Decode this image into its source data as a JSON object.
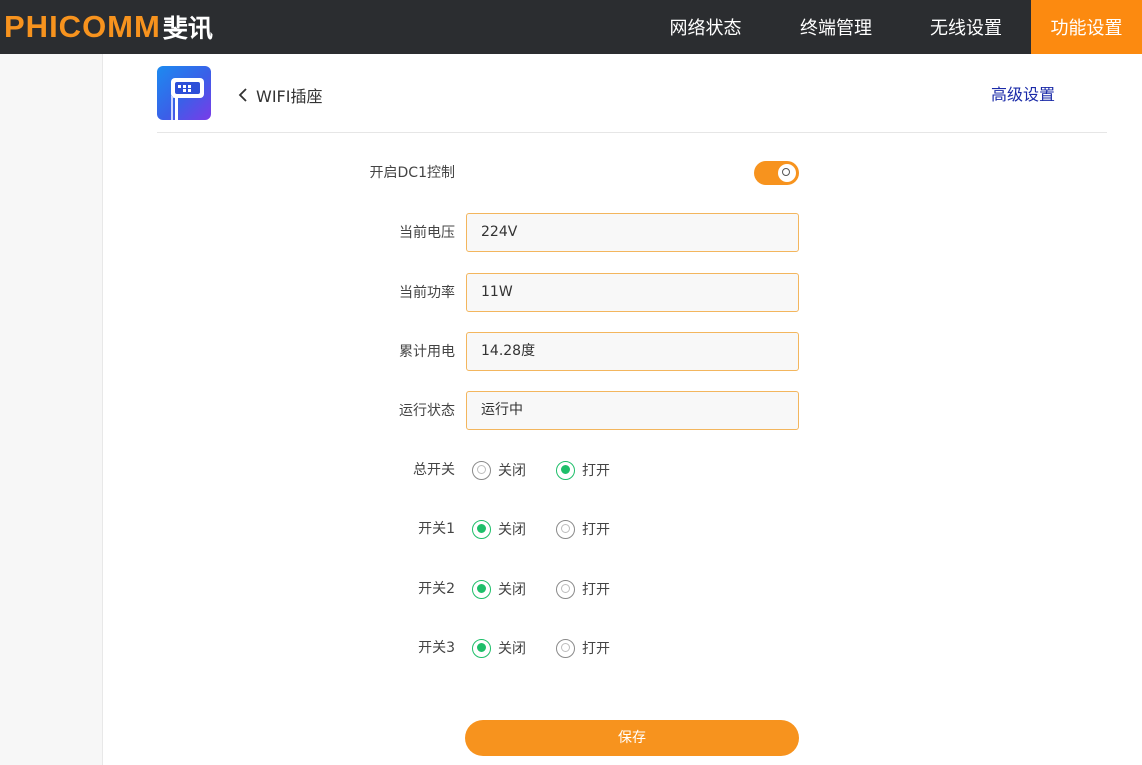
{
  "header": {
    "logo_en": "PHICOMM",
    "logo_cn": "斐讯",
    "nav": [
      "网络状态",
      "终端管理",
      "无线设置",
      "功能设置"
    ],
    "active_nav": "功能设置",
    "brand_color": "#f7931e",
    "bar_color": "#2b2d30"
  },
  "device": {
    "icon": "smart-plug-app-icon",
    "title": "WIFI插座",
    "advanced_link": "高级设置"
  },
  "form": {
    "enable_label": "开启DC1控制",
    "enable_on": true,
    "voltage_label": "当前电压",
    "voltage_value": "224V",
    "power_label": "当前功率",
    "power_value": "11W",
    "energy_label": "累计用电",
    "energy_value": "14.28度",
    "status_label": "运行状态",
    "status_value": "运行中",
    "switches": [
      {
        "label": "总开关",
        "off_label": "关闭",
        "on_label": "打开",
        "selected": "打开"
      },
      {
        "label": "开关1",
        "off_label": "关闭",
        "on_label": "打开",
        "selected": "关闭"
      },
      {
        "label": "开关2",
        "off_label": "关闭",
        "on_label": "打开",
        "selected": "关闭"
      },
      {
        "label": "开关3",
        "off_label": "关闭",
        "on_label": "打开",
        "selected": "关闭"
      }
    ],
    "save_label": "保存",
    "accent_green": "#1fbf6a"
  }
}
